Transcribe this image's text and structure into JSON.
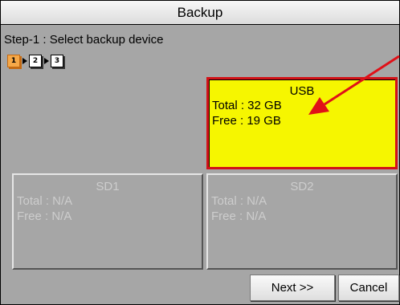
{
  "window": {
    "title": "Backup"
  },
  "step": {
    "label": "Step-1 : Select backup device",
    "indicators": [
      "1",
      "2",
      "3"
    ],
    "current": 1
  },
  "devices": [
    {
      "name": "USB",
      "total": "Total : 32 GB",
      "free": "Free  : 19 GB",
      "state": "selected"
    },
    {
      "name": "SD1",
      "total": "Total : N/A",
      "free": "Free  : N/A",
      "state": "disabled"
    },
    {
      "name": "SD2",
      "total": "Total : N/A",
      "free": "Free  : N/A",
      "state": "disabled"
    }
  ],
  "buttons": {
    "next": "Next >>",
    "cancel": "Cancel"
  },
  "colors": {
    "selected_fill": "#f6f600",
    "selected_border": "#d21218",
    "annotation_arrow": "#e01018",
    "panel_bg": "#a6a6a6"
  }
}
